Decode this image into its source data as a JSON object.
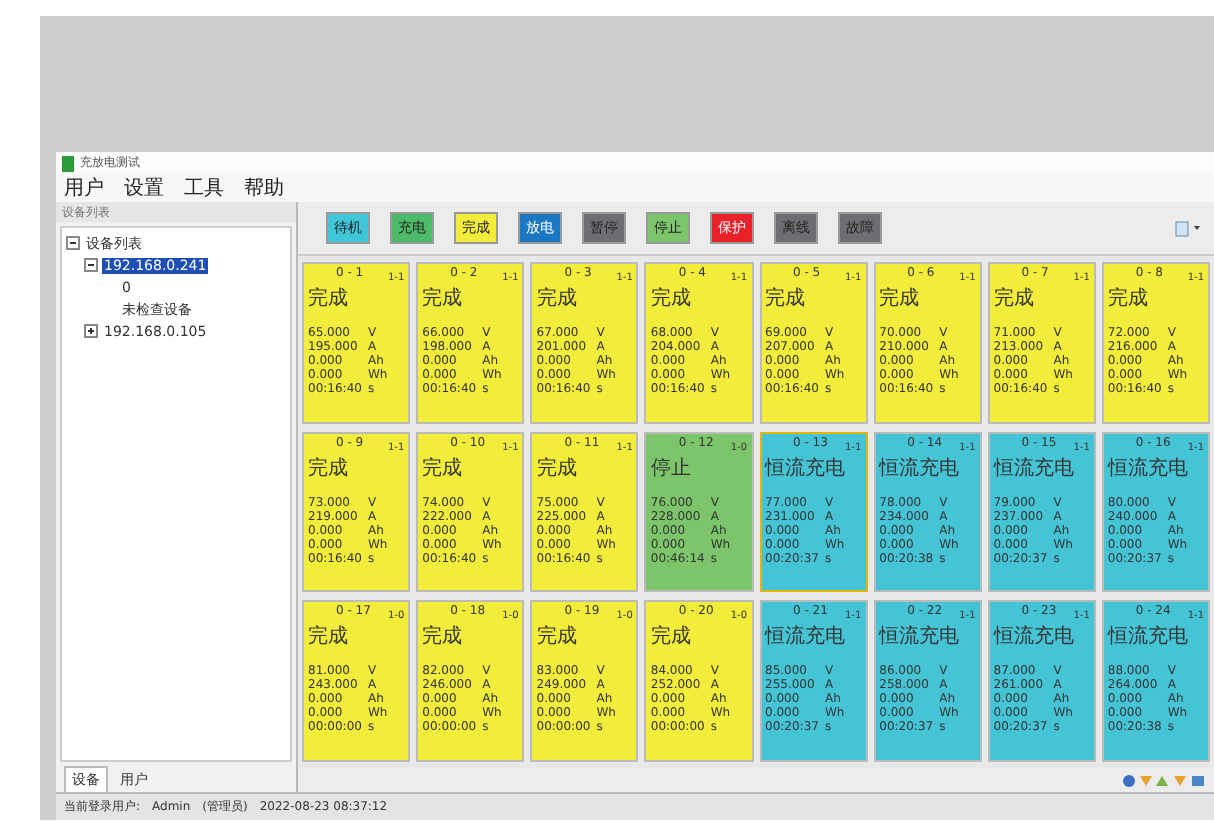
{
  "window": {
    "title": "充放电测试"
  },
  "menu": [
    "用户",
    "设置",
    "工具",
    "帮助"
  ],
  "sidebar": {
    "title": "设备列表",
    "tree": [
      {
        "label": "设备列表",
        "expanded": true,
        "selected": false,
        "children": [
          {
            "label": "192.168.0.241",
            "expanded": true,
            "selected": true,
            "children": [
              {
                "label": "0",
                "selected": false
              },
              {
                "label": "未检查设备",
                "selected": false
              }
            ]
          },
          {
            "label": "192.168.0.105",
            "expanded": false,
            "selected": false
          }
        ]
      }
    ],
    "tabs": [
      {
        "label": "设备",
        "selected": true
      },
      {
        "label": "用户",
        "selected": false
      }
    ]
  },
  "legend": [
    {
      "label": "待机",
      "color": "#3fc6d8"
    },
    {
      "label": "充电",
      "color": "#4cbb6a"
    },
    {
      "label": "完成",
      "color": "#f2ec3a"
    },
    {
      "label": "放电",
      "color": "#1a78c2"
    },
    {
      "label": "暂停",
      "color": "#6e6e72"
    },
    {
      "label": "停止",
      "color": "#7cc56a"
    },
    {
      "label": "保护",
      "color": "#e8222a"
    },
    {
      "label": "离线",
      "color": "#6e6e72"
    },
    {
      "label": "故障",
      "color": "#6e6e72"
    }
  ],
  "cards": [
    {
      "id": "0 - 1",
      "tag": "1-1",
      "status": "完成",
      "kind": "done",
      "selected": false,
      "rows": [
        [
          "65.000",
          "V"
        ],
        [
          "195.000",
          "A"
        ],
        [
          "0.000",
          "Ah"
        ],
        [
          "0.000",
          "Wh"
        ],
        [
          "00:16:40",
          "s"
        ]
      ]
    },
    {
      "id": "0 - 2",
      "tag": "1-1",
      "status": "完成",
      "kind": "done",
      "selected": false,
      "rows": [
        [
          "66.000",
          "V"
        ],
        [
          "198.000",
          "A"
        ],
        [
          "0.000",
          "Ah"
        ],
        [
          "0.000",
          "Wh"
        ],
        [
          "00:16:40",
          "s"
        ]
      ]
    },
    {
      "id": "0 - 3",
      "tag": "1-1",
      "status": "完成",
      "kind": "done",
      "selected": false,
      "rows": [
        [
          "67.000",
          "V"
        ],
        [
          "201.000",
          "A"
        ],
        [
          "0.000",
          "Ah"
        ],
        [
          "0.000",
          "Wh"
        ],
        [
          "00:16:40",
          "s"
        ]
      ]
    },
    {
      "id": "0 - 4",
      "tag": "1-1",
      "status": "完成",
      "kind": "done",
      "selected": false,
      "rows": [
        [
          "68.000",
          "V"
        ],
        [
          "204.000",
          "A"
        ],
        [
          "0.000",
          "Ah"
        ],
        [
          "0.000",
          "Wh"
        ],
        [
          "00:16:40",
          "s"
        ]
      ]
    },
    {
      "id": "0 - 5",
      "tag": "1-1",
      "status": "完成",
      "kind": "done",
      "selected": false,
      "rows": [
        [
          "69.000",
          "V"
        ],
        [
          "207.000",
          "A"
        ],
        [
          "0.000",
          "Ah"
        ],
        [
          "0.000",
          "Wh"
        ],
        [
          "00:16:40",
          "s"
        ]
      ]
    },
    {
      "id": "0 - 6",
      "tag": "1-1",
      "status": "完成",
      "kind": "done",
      "selected": false,
      "rows": [
        [
          "70.000",
          "V"
        ],
        [
          "210.000",
          "A"
        ],
        [
          "0.000",
          "Ah"
        ],
        [
          "0.000",
          "Wh"
        ],
        [
          "00:16:40",
          "s"
        ]
      ]
    },
    {
      "id": "0 - 7",
      "tag": "1-1",
      "status": "完成",
      "kind": "done",
      "selected": false,
      "rows": [
        [
          "71.000",
          "V"
        ],
        [
          "213.000",
          "A"
        ],
        [
          "0.000",
          "Ah"
        ],
        [
          "0.000",
          "Wh"
        ],
        [
          "00:16:40",
          "s"
        ]
      ]
    },
    {
      "id": "0 - 8",
      "tag": "1-1",
      "status": "完成",
      "kind": "done",
      "selected": false,
      "rows": [
        [
          "72.000",
          "V"
        ],
        [
          "216.000",
          "A"
        ],
        [
          "0.000",
          "Ah"
        ],
        [
          "0.000",
          "Wh"
        ],
        [
          "00:16:40",
          "s"
        ]
      ]
    },
    {
      "id": "0 - 9",
      "tag": "1-1",
      "status": "完成",
      "kind": "done",
      "selected": false,
      "rows": [
        [
          "73.000",
          "V"
        ],
        [
          "219.000",
          "A"
        ],
        [
          "0.000",
          "Ah"
        ],
        [
          "0.000",
          "Wh"
        ],
        [
          "00:16:40",
          "s"
        ]
      ]
    },
    {
      "id": "0 - 10",
      "tag": "1-1",
      "status": "完成",
      "kind": "done",
      "selected": false,
      "rows": [
        [
          "74.000",
          "V"
        ],
        [
          "222.000",
          "A"
        ],
        [
          "0.000",
          "Ah"
        ],
        [
          "0.000",
          "Wh"
        ],
        [
          "00:16:40",
          "s"
        ]
      ]
    },
    {
      "id": "0 - 11",
      "tag": "1-1",
      "status": "完成",
      "kind": "done",
      "selected": false,
      "rows": [
        [
          "75.000",
          "V"
        ],
        [
          "225.000",
          "A"
        ],
        [
          "0.000",
          "Ah"
        ],
        [
          "0.000",
          "Wh"
        ],
        [
          "00:16:40",
          "s"
        ]
      ]
    },
    {
      "id": "0 - 12",
      "tag": "1-0",
      "status": "停止",
      "kind": "stopped",
      "selected": false,
      "rows": [
        [
          "76.000",
          "V"
        ],
        [
          "228.000",
          "A"
        ],
        [
          "0.000",
          "Ah"
        ],
        [
          "0.000",
          "Wh"
        ],
        [
          "00:46:14",
          "s"
        ]
      ]
    },
    {
      "id": "0 - 13",
      "tag": "1-1",
      "status": "恒流充电",
      "kind": "charging",
      "selected": true,
      "rows": [
        [
          "77.000",
          "V"
        ],
        [
          "231.000",
          "A"
        ],
        [
          "0.000",
          "Ah"
        ],
        [
          "0.000",
          "Wh"
        ],
        [
          "00:20:37",
          "s"
        ]
      ]
    },
    {
      "id": "0 - 14",
      "tag": "1-1",
      "status": "恒流充电",
      "kind": "charging",
      "selected": false,
      "rows": [
        [
          "78.000",
          "V"
        ],
        [
          "234.000",
          "A"
        ],
        [
          "0.000",
          "Ah"
        ],
        [
          "0.000",
          "Wh"
        ],
        [
          "00:20:38",
          "s"
        ]
      ]
    },
    {
      "id": "0 - 15",
      "tag": "1-1",
      "status": "恒流充电",
      "kind": "charging",
      "selected": false,
      "rows": [
        [
          "79.000",
          "V"
        ],
        [
          "237.000",
          "A"
        ],
        [
          "0.000",
          "Ah"
        ],
        [
          "0.000",
          "Wh"
        ],
        [
          "00:20:37",
          "s"
        ]
      ]
    },
    {
      "id": "0 - 16",
      "tag": "1-1",
      "status": "恒流充电",
      "kind": "charging",
      "selected": false,
      "rows": [
        [
          "80.000",
          "V"
        ],
        [
          "240.000",
          "A"
        ],
        [
          "0.000",
          "Ah"
        ],
        [
          "0.000",
          "Wh"
        ],
        [
          "00:20:37",
          "s"
        ]
      ]
    },
    {
      "id": "0 - 17",
      "tag": "1-0",
      "status": "完成",
      "kind": "done",
      "selected": false,
      "rows": [
        [
          "81.000",
          "V"
        ],
        [
          "243.000",
          "A"
        ],
        [
          "0.000",
          "Ah"
        ],
        [
          "0.000",
          "Wh"
        ],
        [
          "00:00:00",
          "s"
        ]
      ]
    },
    {
      "id": "0 - 18",
      "tag": "1-0",
      "status": "完成",
      "kind": "done",
      "selected": false,
      "rows": [
        [
          "82.000",
          "V"
        ],
        [
          "246.000",
          "A"
        ],
        [
          "0.000",
          "Ah"
        ],
        [
          "0.000",
          "Wh"
        ],
        [
          "00:00:00",
          "s"
        ]
      ]
    },
    {
      "id": "0 - 19",
      "tag": "1-0",
      "status": "完成",
      "kind": "done",
      "selected": false,
      "rows": [
        [
          "83.000",
          "V"
        ],
        [
          "249.000",
          "A"
        ],
        [
          "0.000",
          "Ah"
        ],
        [
          "0.000",
          "Wh"
        ],
        [
          "00:00:00",
          "s"
        ]
      ]
    },
    {
      "id": "0 - 20",
      "tag": "1-0",
      "status": "完成",
      "kind": "done",
      "selected": false,
      "rows": [
        [
          "84.000",
          "V"
        ],
        [
          "252.000",
          "A"
        ],
        [
          "0.000",
          "Ah"
        ],
        [
          "0.000",
          "Wh"
        ],
        [
          "00:00:00",
          "s"
        ]
      ]
    },
    {
      "id": "0 - 21",
      "tag": "1-1",
      "status": "恒流充电",
      "kind": "charging",
      "selected": false,
      "rows": [
        [
          "85.000",
          "V"
        ],
        [
          "255.000",
          "A"
        ],
        [
          "0.000",
          "Ah"
        ],
        [
          "0.000",
          "Wh"
        ],
        [
          "00:20:37",
          "s"
        ]
      ]
    },
    {
      "id": "0 - 22",
      "tag": "1-1",
      "status": "恒流充电",
      "kind": "charging",
      "selected": false,
      "rows": [
        [
          "86.000",
          "V"
        ],
        [
          "258.000",
          "A"
        ],
        [
          "0.000",
          "Ah"
        ],
        [
          "0.000",
          "Wh"
        ],
        [
          "00:20:37",
          "s"
        ]
      ]
    },
    {
      "id": "0 - 23",
      "tag": "1-1",
      "status": "恒流充电",
      "kind": "charging",
      "selected": false,
      "rows": [
        [
          "87.000",
          "V"
        ],
        [
          "261.000",
          "A"
        ],
        [
          "0.000",
          "Ah"
        ],
        [
          "0.000",
          "Wh"
        ],
        [
          "00:20:37",
          "s"
        ]
      ]
    },
    {
      "id": "0 - 24",
      "tag": "1-1",
      "status": "恒流充电",
      "kind": "charging",
      "selected": false,
      "rows": [
        [
          "88.000",
          "V"
        ],
        [
          "264.000",
          "A"
        ],
        [
          "0.000",
          "Ah"
        ],
        [
          "0.000",
          "Wh"
        ],
        [
          "00:20:38",
          "s"
        ]
      ]
    }
  ],
  "status_bar": {
    "user_label": "当前登录用户:",
    "user": "Admin",
    "role": "(管理员)",
    "time": "2022-08-23 08:37:12"
  }
}
